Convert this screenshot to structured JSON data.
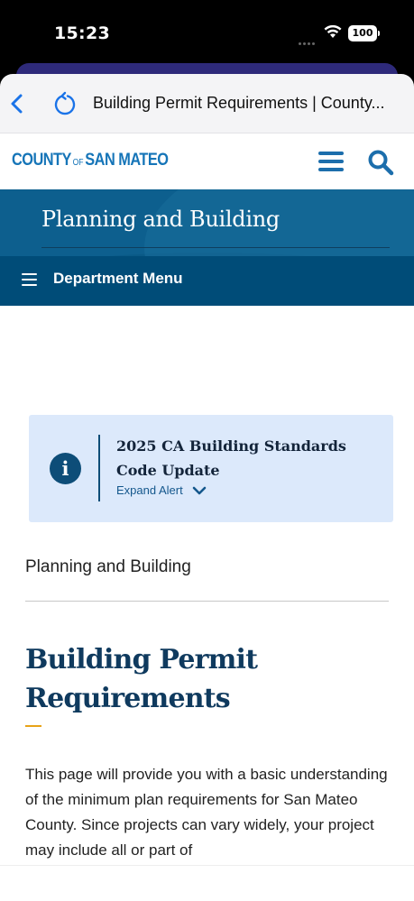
{
  "status_bar": {
    "time": "15:23",
    "battery": "100",
    "icons": [
      "signal-dots-icon",
      "wifi-icon",
      "battery-icon"
    ]
  },
  "browser": {
    "title": "Building Permit Requirements | County..."
  },
  "site": {
    "logo": {
      "county": "COUNTY",
      "of": "OF",
      "name": "SAN MATEO"
    },
    "brand_color": "#1675b8"
  },
  "department": {
    "title": "Planning and Building",
    "menu_label": "Department Menu",
    "banner_color": "#0d5f8e"
  },
  "alert": {
    "title": "2025 CA Building Standards Code Update",
    "expand_label": "Expand Alert",
    "background": "#dce9fb"
  },
  "breadcrumb": "Planning and Building",
  "page": {
    "title": "Building Permit Requirements",
    "accent_color": "#e8a317",
    "intro": "This page will provide you with a basic understanding of the minimum plan requirements for San Mateo County. Since projects can vary widely, your project may include all or part of"
  }
}
